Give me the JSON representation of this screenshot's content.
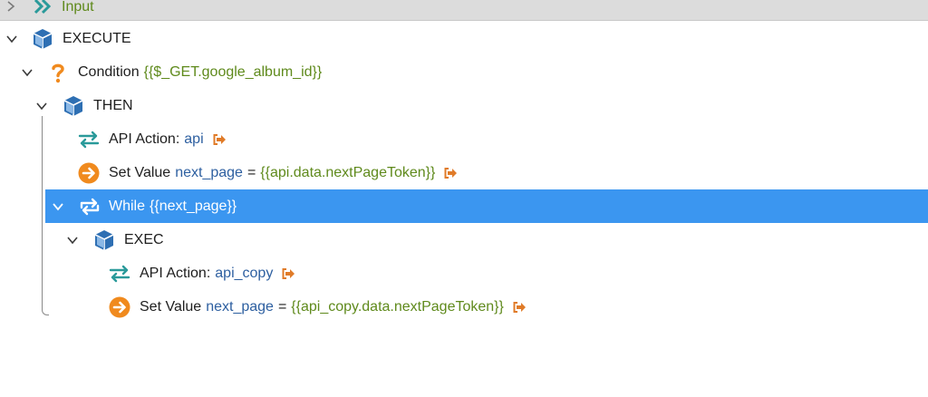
{
  "tree": {
    "input": {
      "label": "Input"
    },
    "execute": {
      "label": "EXECUTE"
    },
    "condition": {
      "label": "Condition",
      "value": "{{$_GET.google_album_id}}"
    },
    "then": {
      "label": "THEN"
    },
    "api_action": {
      "label": "API Action:",
      "name": "api"
    },
    "set_value_1": {
      "label": "Set Value",
      "var": "next_page",
      "op": "=",
      "value": "{{api.data.nextPageToken}}"
    },
    "while": {
      "label": "While",
      "value": "{{next_page}}"
    },
    "exec": {
      "label": "EXEC"
    },
    "api_action_copy": {
      "label": "API Action:",
      "name": "api_copy"
    },
    "set_value_2": {
      "label": "Set Value",
      "var": "next_page",
      "op": "=",
      "value": "{{api_copy.data.nextPageToken}}"
    }
  },
  "colors": {
    "selected_bg": "#3b96f0",
    "module_blue": "#2e6fb3",
    "orange": "#f08a1e",
    "teal": "#2a9a9a",
    "value_green": "#5f8a1c",
    "var_blue": "#2d5fa0"
  },
  "icons": {
    "chevron": "chevron-icon",
    "module": "cube-icon",
    "condition": "question-icon",
    "api": "swap-arrows-icon",
    "set_value": "arrow-circle-icon",
    "while": "repeat-icon",
    "link": "goto-link-icon"
  }
}
